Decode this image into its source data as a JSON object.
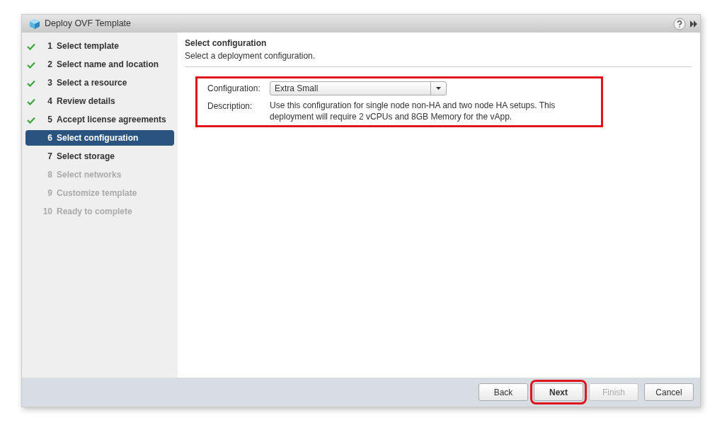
{
  "window": {
    "title": "Deploy OVF Template"
  },
  "steps": [
    {
      "number": "1",
      "label": "Select template",
      "checked": true,
      "selected": false,
      "disabled": false
    },
    {
      "number": "2",
      "label": "Select name and location",
      "checked": true,
      "selected": false,
      "disabled": false
    },
    {
      "number": "3",
      "label": "Select a resource",
      "checked": true,
      "selected": false,
      "disabled": false
    },
    {
      "number": "4",
      "label": "Review details",
      "checked": true,
      "selected": false,
      "disabled": false
    },
    {
      "number": "5",
      "label": "Accept license agreements",
      "checked": true,
      "selected": false,
      "disabled": false
    },
    {
      "number": "6",
      "label": "Select configuration",
      "checked": false,
      "selected": true,
      "disabled": false
    },
    {
      "number": "7",
      "label": "Select storage",
      "checked": false,
      "selected": false,
      "disabled": false
    },
    {
      "number": "8",
      "label": "Select networks",
      "checked": false,
      "selected": false,
      "disabled": true
    },
    {
      "number": "9",
      "label": "Customize template",
      "checked": false,
      "selected": false,
      "disabled": true
    },
    {
      "number": "10",
      "label": "Ready to complete",
      "checked": false,
      "selected": false,
      "disabled": true
    }
  ],
  "page": {
    "title": "Select configuration",
    "subtitle": "Select a deployment configuration.",
    "highlighted": true,
    "configuration_label": "Configuration:",
    "configuration_value": "Extra Small",
    "description_label": "Description:",
    "description": "Use this configuration for single node non-HA and two node HA setups.  This deployment will require 2 vCPUs and 8GB Memory for the vApp."
  },
  "buttons": [
    {
      "label": "Back",
      "disabled": false,
      "highlighted": false
    },
    {
      "label": "Next",
      "disabled": false,
      "highlighted": true
    },
    {
      "label": "Finish",
      "disabled": true,
      "highlighted": false
    },
    {
      "label": "Cancel",
      "disabled": false,
      "highlighted": false
    }
  ]
}
